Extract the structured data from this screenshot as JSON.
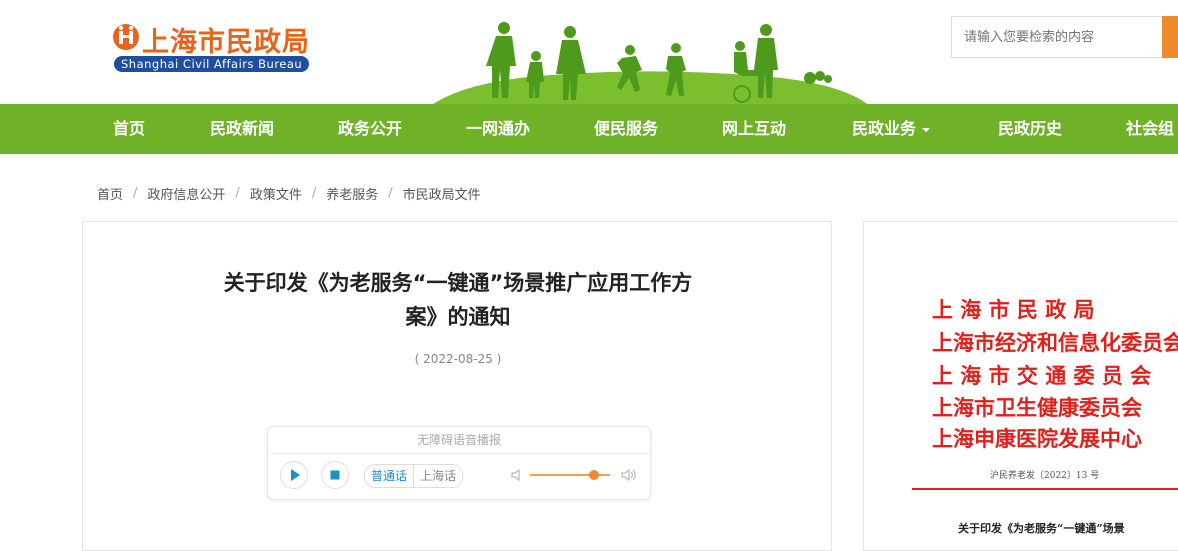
{
  "header": {
    "logo_title": "上海市民政局",
    "logo_subtitle": "Shanghai Civil Affairs Bureau",
    "search_placeholder": "请输入您要检索的内容"
  },
  "nav": {
    "items": [
      {
        "label": "首页"
      },
      {
        "label": "民政新闻"
      },
      {
        "label": "政务公开"
      },
      {
        "label": "一网通办"
      },
      {
        "label": "便民服务"
      },
      {
        "label": "网上互动"
      },
      {
        "label": "民政业务"
      },
      {
        "label": "民政历史"
      },
      {
        "label": "社会组"
      }
    ]
  },
  "breadcrumb": [
    "首页",
    "政府信息公开",
    "政策文件",
    "养老服务",
    "市民政局文件"
  ],
  "article": {
    "title_line1": "关于印发《为老服务“一键通”场景推广应用工作方",
    "title_line2": "案》的通知",
    "date": "( 2022-08-25 )"
  },
  "player": {
    "title": "无障碍语音播报",
    "lang_mandarin": "普通话",
    "lang_shanghai": "上海话",
    "volume_level": 0.8
  },
  "document_preview": {
    "issuers": [
      "上 海 市 民 政 局",
      "上海市经济和信息化委员会",
      "上 海 市 交 通 委 员 会",
      "上海市卫生健康委员会",
      "上海申康医院发展中心"
    ],
    "doc_number": "沪民养老发〔2022〕13 号",
    "subtitle": "关于印发《为老服务“一键通”场景"
  },
  "colors": {
    "nav_green": "#6fb127",
    "logo_orange": "#e8641a",
    "logo_blue": "#1d4ea0",
    "accent_orange": "#f08a2c",
    "document_red": "#e0201b"
  }
}
